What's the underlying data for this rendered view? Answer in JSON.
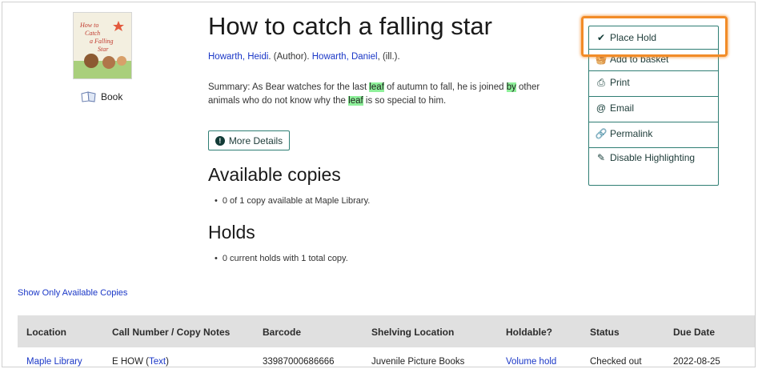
{
  "record": {
    "title": "How to catch a falling star",
    "cover_text": "How to Catch a Falling Star",
    "author1": "Howarth, Heidi",
    "author1_role": ". (Author). ",
    "author2": "Howarth, Daniel",
    "author2_role": ", (ill.).",
    "summary_p1": "Summary: As Bear watches for the last ",
    "summary_hl1": "leaf",
    "summary_p2": " of autumn to fall, he is joined ",
    "summary_hl2": "by",
    "summary_p3": " other animals who do not know why the ",
    "summary_hl3": "leaf",
    "summary_p4": " is so special to him.",
    "format": "Book",
    "format_icon": "book-icon",
    "more_details": "More Details"
  },
  "copies": {
    "heading": "Available copies",
    "line": "0 of 1 copy available at Maple Library."
  },
  "holds": {
    "heading": "Holds",
    "line": "0 current holds with 1 total copy."
  },
  "actions": [
    {
      "label": "Place Hold",
      "icon": "check-icon",
      "glyph": "✔"
    },
    {
      "label": "Add to basket",
      "icon": "basket-icon",
      "glyph": "🧺"
    },
    {
      "label": "Print",
      "icon": "printer-icon",
      "glyph": "⎙"
    },
    {
      "label": "Email",
      "icon": "email-icon",
      "glyph": "@"
    },
    {
      "label": "Permalink",
      "icon": "link-icon",
      "glyph": "🔗"
    },
    {
      "label": "Disable Highlighting",
      "icon": "marker-icon",
      "glyph": "✎"
    }
  ],
  "show_available": "Show Only Available Copies",
  "table": {
    "headers": [
      "Location",
      "Call Number / Copy Notes",
      "Barcode",
      "Shelving Location",
      "Holdable?",
      "Status",
      "Due Date"
    ],
    "row": {
      "location": "Maple Library",
      "call_number": "E HOW",
      "call_note": "Text",
      "barcode": "33987000686666",
      "shelving": "Juvenile Picture Books",
      "holdable": "Volume hold",
      "status": "Checked out",
      "due_date": "2022-08-25"
    }
  },
  "colors": {
    "link": "#1a37c7",
    "accent": "#2f7e74",
    "highlight_term": "#8ef09a",
    "focus_outline": "#f28c28",
    "table_header_bg": "#e0e0e0"
  }
}
